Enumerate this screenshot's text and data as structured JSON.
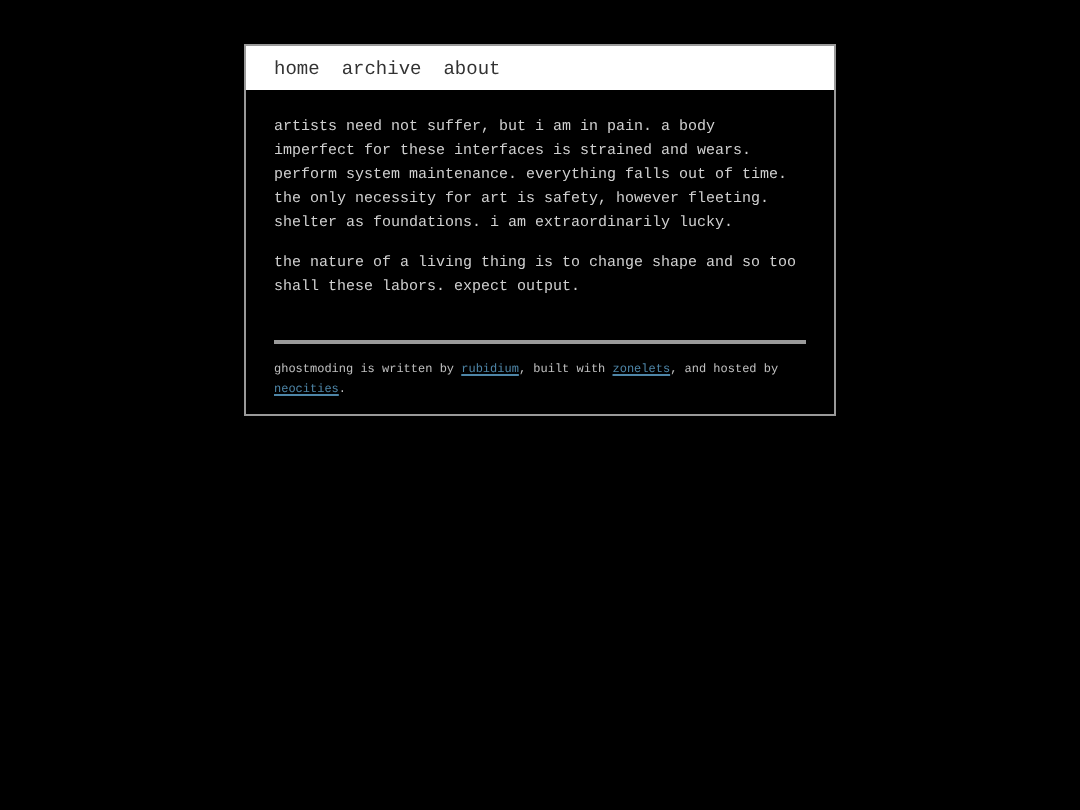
{
  "nav": [
    {
      "label": "home"
    },
    {
      "label": "archive"
    },
    {
      "label": "about"
    }
  ],
  "paragraphs": [
    "artists need not suffer, but i am in pain. a body imperfect for these interfaces is strained and wears. perform system maintenance. everything falls out of time. the only necessity for art is safety, however fleeting. shelter as foundations. i am extraordinarily lucky.",
    "the nature of a living thing is to change shape and so too shall these labors. expect output."
  ],
  "footer": [
    {
      "kind": "text",
      "text": "ghostmoding is written by "
    },
    {
      "kind": "link",
      "text": "rubidium"
    },
    {
      "kind": "text",
      "text": ", built with "
    },
    {
      "kind": "link",
      "text": "zonelets"
    },
    {
      "kind": "text",
      "text": ", and hosted by "
    },
    {
      "kind": "link",
      "text": "neocities"
    },
    {
      "kind": "text",
      "text": "."
    }
  ]
}
